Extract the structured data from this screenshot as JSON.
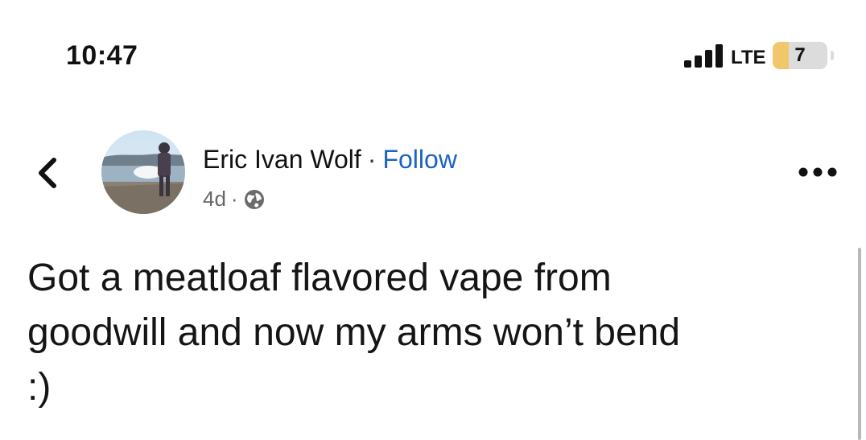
{
  "status_bar": {
    "time": "10:47",
    "network": "LTE",
    "battery_level": "7",
    "battery_fraction": 0.3,
    "battery_fill_color": "#f1c76b"
  },
  "post": {
    "author": "Eric Ivan Wolf",
    "separator": "·",
    "follow_label": "Follow",
    "timestamp": "4d",
    "meta_separator": "·",
    "audience_icon": "globe-icon",
    "back_icon": "chevron-left-icon",
    "more_icon": "more-horizontal-icon",
    "text": "Got a meatloaf flavored vape from\ngoodwill and now my arms won’t bend\n:)"
  },
  "colors": {
    "link": "#1b63c6",
    "text": "#151515",
    "muted": "#666666"
  }
}
